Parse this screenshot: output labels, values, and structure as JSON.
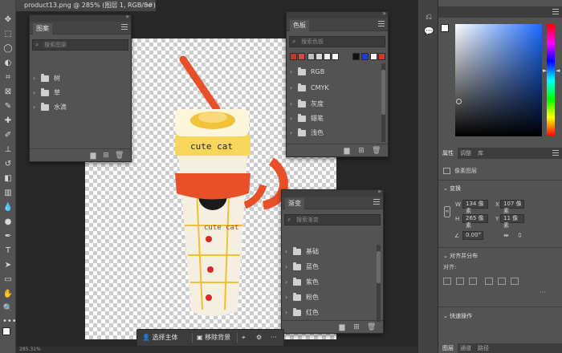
{
  "document_tab": {
    "title": "product13.png @ 285% (图层 1, RGB/8#) *",
    "close": "×"
  },
  "patterns_panel": {
    "title": "图案",
    "search_placeholder": "搜索图案",
    "items": [
      {
        "label": "树"
      },
      {
        "label": "草"
      },
      {
        "label": "水滴"
      }
    ]
  },
  "swatches_panel": {
    "title": "色板",
    "search_placeholder": "搜索色板",
    "swatches": [
      "#c0392b",
      "#d04a4a",
      "#bfbfbf",
      "#d9d9d9",
      "#eeeeee",
      "#ffffff",
      "#111111",
      "#1a3fd8",
      "#ffffff",
      "#e8302a"
    ],
    "items": [
      {
        "label": "RGB"
      },
      {
        "label": "CMYK"
      },
      {
        "label": "灰度"
      },
      {
        "label": "蜡笔"
      },
      {
        "label": "浅色"
      }
    ]
  },
  "gradients_panel": {
    "title": "渐变",
    "search_placeholder": "搜索渐变",
    "items": [
      {
        "label": "基础"
      },
      {
        "label": "蓝色"
      },
      {
        "label": "紫色"
      },
      {
        "label": "粉色"
      },
      {
        "label": "红色"
      }
    ]
  },
  "product_text": {
    "top_band": "cute cat",
    "body": "cute cat"
  },
  "properties_panel": {
    "tabs": [
      "属性",
      "调整",
      "库"
    ],
    "layer_type": "像素图层",
    "transform_title": "变换",
    "w_label": "W",
    "w_value": "134 像素",
    "h_label": "H",
    "h_value": "265 像素",
    "x_label": "X",
    "x_value": "107 像素",
    "y_label": "Y",
    "y_value": "11 像素",
    "angle_value": "0.00°",
    "align_title": "对齐并分布",
    "align_label": "对齐:",
    "quick_title": "快速操作"
  },
  "bottom_tabs": [
    "图层",
    "通道",
    "路径"
  ],
  "context_bar": {
    "select_subject": "选择主体",
    "remove_bg": "移除背景",
    "more": "···"
  },
  "status_bar": {
    "text": "285.31%"
  },
  "colors": {
    "foreground": "#ffffff",
    "background": "#000000",
    "accent": "#1473e6"
  }
}
